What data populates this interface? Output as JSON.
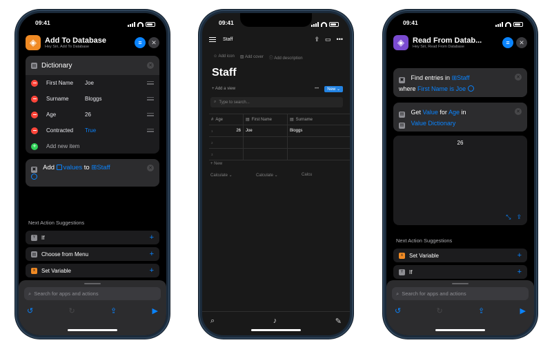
{
  "status": {
    "time": "09:41"
  },
  "phone1": {
    "title": "Add To Database",
    "subtitle": "Hey Siri, Add To Database",
    "dictionary": {
      "title": "Dictionary",
      "rows": [
        {
          "key": "First Name",
          "value": "Joe"
        },
        {
          "key": "Surname",
          "value": "Bloggs"
        },
        {
          "key": "Age",
          "value": "26"
        },
        {
          "key": "Contracted",
          "value": "True"
        }
      ],
      "add_label": "Add new item"
    },
    "add_action": {
      "verb": "Add",
      "values": "values",
      "to": "to",
      "db": "Staff"
    },
    "suggestions_title": "Next Action Suggestions",
    "suggestions": [
      "If",
      "Choose from Menu",
      "Set Variable"
    ],
    "search_placeholder": "Search for apps and actions"
  },
  "phone2": {
    "breadcrumb": "Staff",
    "props": [
      "Add icon",
      "Add cover",
      "Add description"
    ],
    "title": "Staff",
    "add_view": "Add a view",
    "new_button": "New",
    "search_placeholder": "Type to search...",
    "columns": [
      "Age",
      "First Name",
      "Surname"
    ],
    "rows": [
      {
        "num": "1",
        "age": "26",
        "first": "Joe",
        "surname": "Bloggs"
      },
      {
        "num": "2",
        "age": "",
        "first": "",
        "surname": ""
      },
      {
        "num": "3",
        "age": "",
        "first": "",
        "surname": ""
      }
    ],
    "new_row": "New",
    "calc": [
      "Calculate",
      "Calculate",
      "Calcu"
    ]
  },
  "phone3": {
    "title": "Read From Datab...",
    "subtitle": "Hey Siri, Read From Database",
    "find": {
      "prefix": "Find entries in",
      "db": "Staff",
      "where": "where",
      "field": "First Name",
      "is": "is",
      "value": "Joe"
    },
    "get": {
      "verb": "Get",
      "value": "Value",
      "for": "for",
      "key": "Age",
      "in": "in",
      "source": "Value Dictionary"
    },
    "result": "26",
    "suggestions_title": "Next Action Suggestions",
    "suggestions": [
      "Set Variable",
      "If"
    ],
    "search_placeholder": "Search for apps and actions"
  }
}
